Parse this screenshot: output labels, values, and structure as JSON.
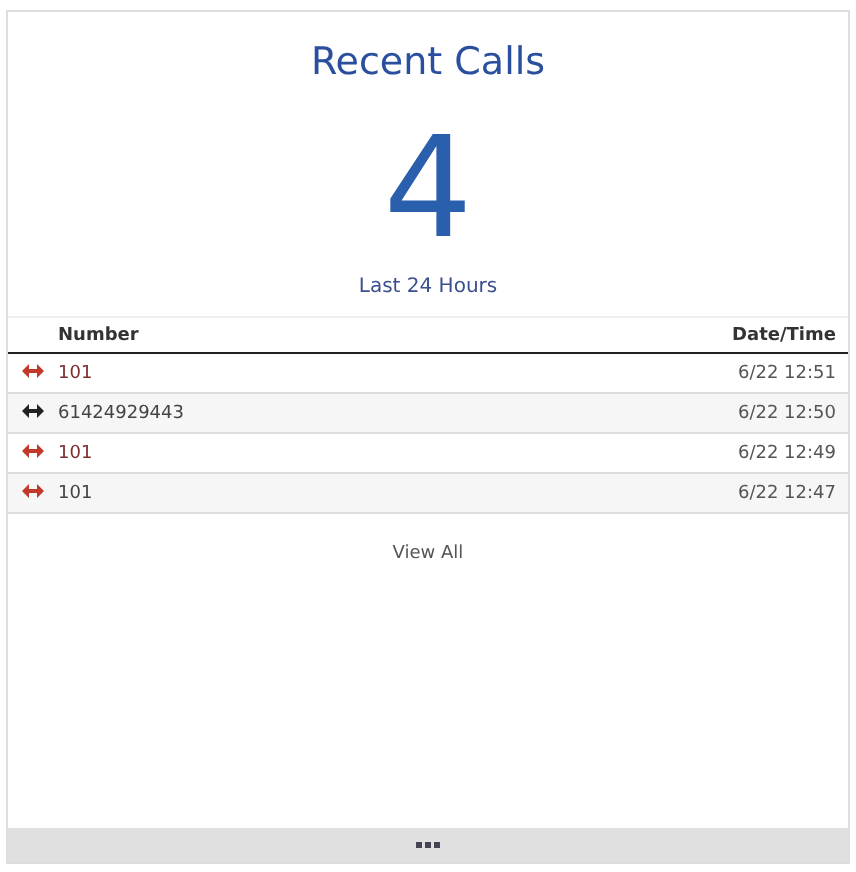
{
  "title": "Recent Calls",
  "count": "4",
  "period": "Last 24 Hours",
  "table": {
    "columns": [
      "Number",
      "Date/Time"
    ],
    "rows": [
      {
        "color": "#c0392b",
        "number": "101",
        "time": "6/22 12:51"
      },
      {
        "color": "#222222",
        "number": "61424929443",
        "time": "6/22 12:50"
      },
      {
        "color": "#c0392b",
        "number": "101",
        "time": "6/22 12:49"
      },
      {
        "color": "#c0392b",
        "number": "101",
        "time": "6/22 12:47"
      }
    ]
  },
  "link": "View All"
}
